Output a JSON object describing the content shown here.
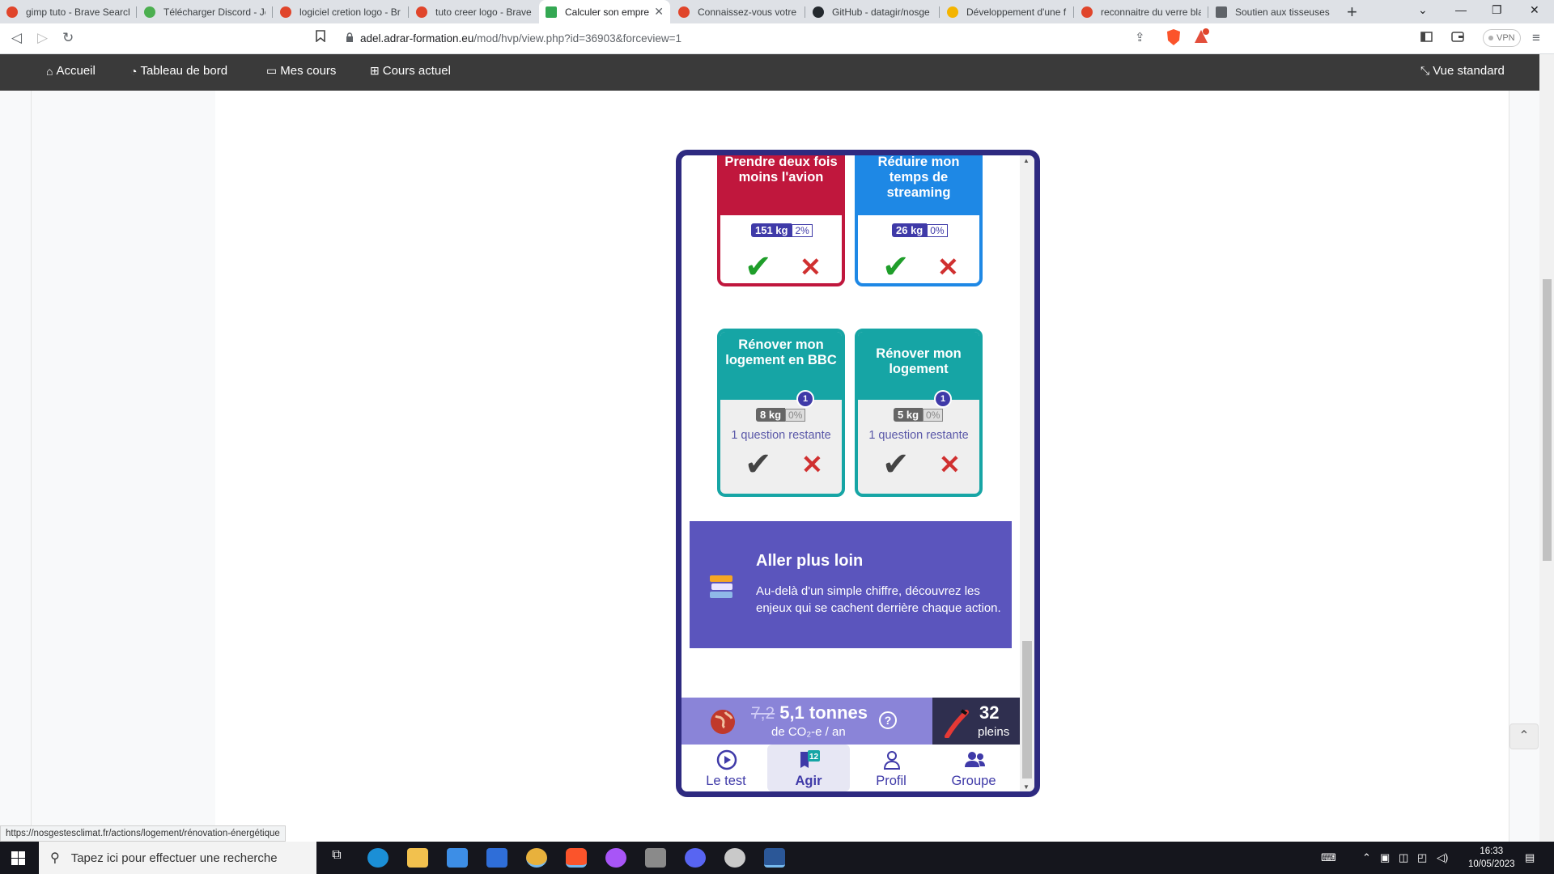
{
  "browser": {
    "tabs": [
      {
        "title": "gimp tuto - Brave Search",
        "color": "#e0452b"
      },
      {
        "title": "Télécharger Discord - Je",
        "color": "#4caf50"
      },
      {
        "title": "logiciel cretion logo - Br",
        "color": "#e0452b"
      },
      {
        "title": "tuto creer logo - Brave S",
        "color": "#e0452b"
      },
      {
        "title": "Calculer son empre",
        "color": "#34a853",
        "active": true
      },
      {
        "title": "Connaissez-vous votre e",
        "color": "#e0452b"
      },
      {
        "title": "GitHub - datagir/nosge",
        "color": "#24292e"
      },
      {
        "title": "Développement d'une f",
        "color": "#f4b400"
      },
      {
        "title": "reconnaitre du verre bla",
        "color": "#e0452b"
      },
      {
        "title": "Soutien aux tisseuses de",
        "color": "#5f6368"
      }
    ],
    "url_domain": "adel.adrar-formation.eu",
    "url_path": "/mod/hvp/view.php?id=36903&forceview=1",
    "vpn_label": "VPN"
  },
  "site_nav": {
    "home": "Accueil",
    "dashboard": "Tableau de bord",
    "my_courses": "Mes cours",
    "current_course": "Cours actuel",
    "standard_view": "Vue standard"
  },
  "actions": [
    {
      "title": "Prendre deux fois moins l'avion",
      "kg": "151 kg",
      "pct": "2%",
      "color": "#c0173d"
    },
    {
      "title": "Réduire mon temps de streaming",
      "kg": "26 kg",
      "pct": "0%",
      "color": "#1e88e5"
    },
    {
      "title": "Rénover mon logement en BBC",
      "kg": "8 kg",
      "pct": "0%",
      "color": "#16a5a5",
      "badge": "1",
      "remaining": "1 question restante"
    },
    {
      "title": "Rénover mon logement",
      "kg": "5 kg",
      "pct": "0%",
      "color": "#16a5a5",
      "badge": "1",
      "remaining": "1 question restante"
    }
  ],
  "further": {
    "title": "Aller plus loin",
    "text": "Au-delà d'un simple chiffre, découvrez les enjeux qui se cachent derrière chaque action."
  },
  "footprint": {
    "old_value": "7,2",
    "value": "5,1 tonnes",
    "unit": "de CO₂-e / an",
    "help": "?",
    "pleins_value": "32",
    "pleins_label": "pleins"
  },
  "app_nav": [
    {
      "label": "Le test"
    },
    {
      "label": "Agir",
      "badge": "12",
      "active": true
    },
    {
      "label": "Profil"
    },
    {
      "label": "Groupe"
    }
  ],
  "status_url": "https://nosgestesclimat.fr/actions/logement/rénovation-énergétique",
  "taskbar": {
    "search_placeholder": "Tapez ici pour effectuer une recherche",
    "time": "16:33",
    "date": "10/05/2023"
  }
}
